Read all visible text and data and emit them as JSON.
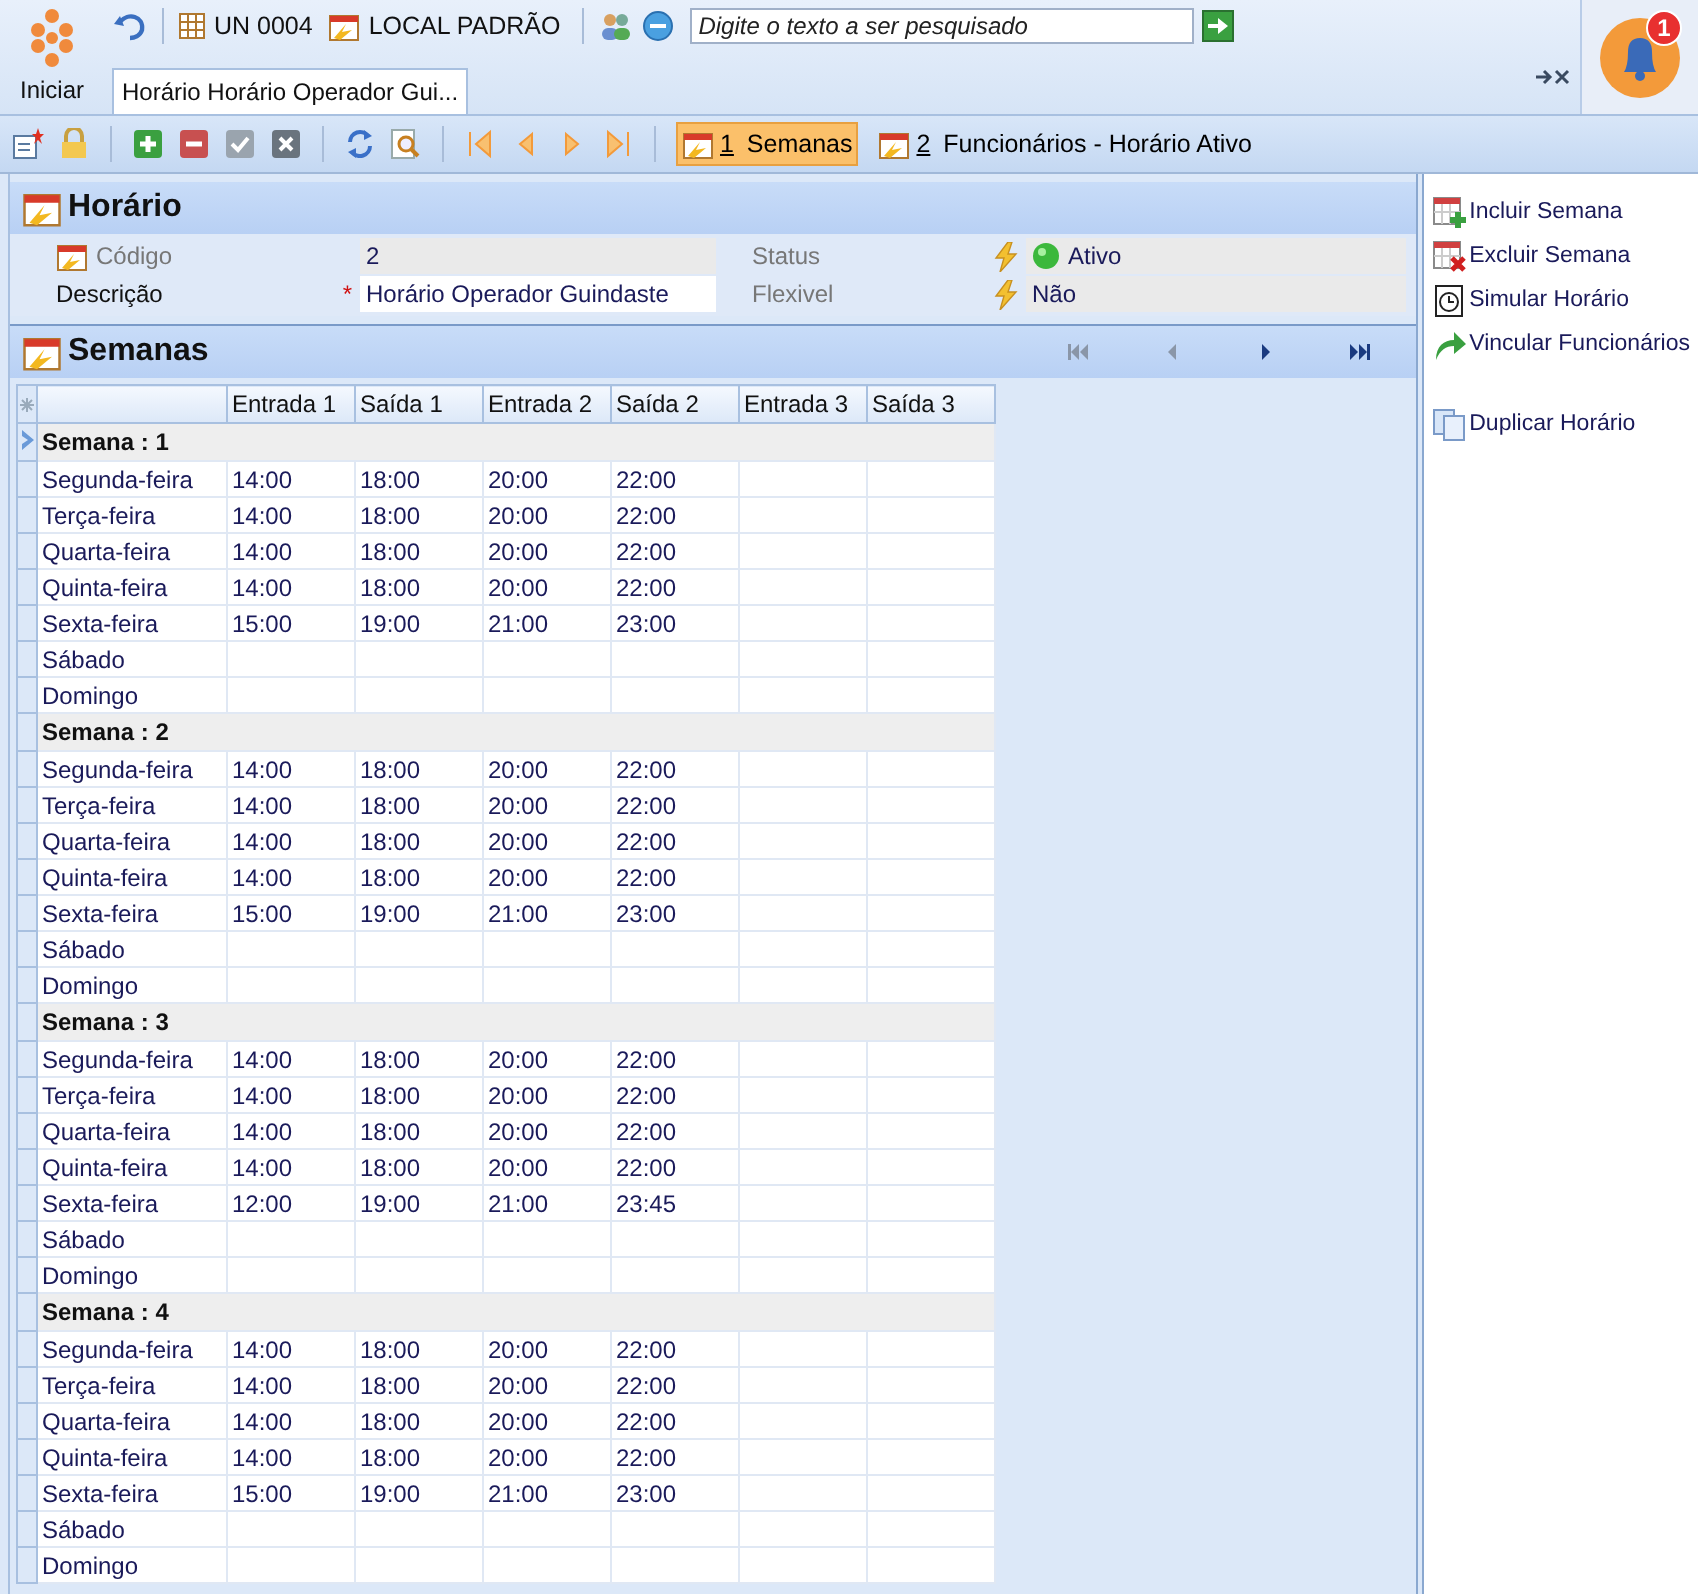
{
  "start": {
    "label": "Iniciar"
  },
  "topbar": {
    "unit": "UN 0004",
    "location": "LOCAL PADRÃO",
    "search": {
      "placeholder": "Digite o texto a ser pesquisado"
    }
  },
  "notifications": {
    "count": "1"
  },
  "tabs": [
    {
      "label": "Horário Horário Operador Gui...",
      "selected": true
    }
  ],
  "toolbar": [
    {
      "kind": "new"
    },
    {
      "kind": "lock"
    },
    {
      "kind": "add"
    },
    {
      "kind": "remove"
    },
    {
      "kind": "confirm",
      "disabled": true
    },
    {
      "kind": "cancel",
      "disabled": true
    },
    {
      "kind": "refresh"
    },
    {
      "kind": "find"
    },
    {
      "kind": "first"
    },
    {
      "kind": "prev"
    },
    {
      "kind": "next"
    },
    {
      "kind": "last"
    }
  ],
  "views": [
    {
      "key": "1",
      "label": "Semanas",
      "selected": true
    },
    {
      "key": "2",
      "label": "Funcionários - Horário Ativo",
      "selected": false
    }
  ],
  "form": {
    "title": "Horário",
    "rows": [
      [
        {
          "label": "Código",
          "value": "2",
          "kind": "text",
          "readonly": true,
          "icon": true
        },
        {
          "label": "Status",
          "value": "Ativo",
          "kind": "status",
          "readonly": true
        }
      ],
      [
        {
          "label": "Descrição",
          "value": "Horário Operador Guindaste",
          "kind": "text",
          "readonly": false,
          "marker": "*"
        },
        {
          "label": "Flexivel",
          "value": "Não",
          "kind": "text",
          "readonly": true
        }
      ]
    ]
  },
  "weeks_panel": {
    "title": "Semanas",
    "pager": [
      {
        "kind": "first",
        "disabled": true
      },
      {
        "kind": "prev",
        "disabled": true
      },
      {
        "kind": "next",
        "disabled": false
      },
      {
        "kind": "last",
        "disabled": false
      }
    ],
    "columns": [
      "Entrada 1",
      "Saída 1",
      "Entrada 2",
      "Saída 2",
      "Entrada 3",
      "Saída 3"
    ],
    "weeks": [
      {
        "title": "Semana : 1",
        "selected": true,
        "days": [
          {
            "day": "Segunda-feira",
            "times": [
              "14:00",
              "18:00",
              "20:00",
              "22:00"
            ]
          },
          {
            "day": "Terça-feira",
            "times": [
              "14:00",
              "18:00",
              "20:00",
              "22:00"
            ]
          },
          {
            "day": "Quarta-feira",
            "times": [
              "14:00",
              "18:00",
              "20:00",
              "22:00"
            ]
          },
          {
            "day": "Quinta-feira",
            "times": [
              "14:00",
              "18:00",
              "20:00",
              "22:00"
            ]
          },
          {
            "day": "Sexta-feira",
            "times": [
              "15:00",
              "19:00",
              "21:00",
              "23:00"
            ]
          },
          {
            "day": "Sábado"
          },
          {
            "day": "Domingo"
          }
        ]
      },
      {
        "title": "Semana : 2",
        "selected": false,
        "days": [
          {
            "day": "Segunda-feira",
            "times": [
              "14:00",
              "18:00",
              "20:00",
              "22:00"
            ]
          },
          {
            "day": "Terça-feira",
            "times": [
              "14:00",
              "18:00",
              "20:00",
              "22:00"
            ]
          },
          {
            "day": "Quarta-feira",
            "times": [
              "14:00",
              "18:00",
              "20:00",
              "22:00"
            ]
          },
          {
            "day": "Quinta-feira",
            "times": [
              "14:00",
              "18:00",
              "20:00",
              "22:00"
            ]
          },
          {
            "day": "Sexta-feira",
            "times": [
              "15:00",
              "19:00",
              "21:00",
              "23:00"
            ]
          },
          {
            "day": "Sábado"
          },
          {
            "day": "Domingo"
          }
        ]
      },
      {
        "title": "Semana : 3",
        "selected": false,
        "days": [
          {
            "day": "Segunda-feira",
            "times": [
              "14:00",
              "18:00",
              "20:00",
              "22:00"
            ]
          },
          {
            "day": "Terça-feira",
            "times": [
              "14:00",
              "18:00",
              "20:00",
              "22:00"
            ]
          },
          {
            "day": "Quarta-feira",
            "times": [
              "14:00",
              "18:00",
              "20:00",
              "22:00"
            ]
          },
          {
            "day": "Quinta-feira",
            "times": [
              "14:00",
              "18:00",
              "20:00",
              "22:00"
            ]
          },
          {
            "day": "Sexta-feira",
            "times": [
              "12:00",
              "19:00",
              "21:00",
              "23:45"
            ]
          },
          {
            "day": "Sábado"
          },
          {
            "day": "Domingo"
          }
        ]
      },
      {
        "title": "Semana : 4",
        "selected": false,
        "days": [
          {
            "day": "Segunda-feira",
            "times": [
              "14:00",
              "18:00",
              "20:00",
              "22:00"
            ]
          },
          {
            "day": "Terça-feira",
            "times": [
              "14:00",
              "18:00",
              "20:00",
              "22:00"
            ]
          },
          {
            "day": "Quarta-feira",
            "times": [
              "14:00",
              "18:00",
              "20:00",
              "22:00"
            ]
          },
          {
            "day": "Quinta-feira",
            "times": [
              "14:00",
              "18:00",
              "20:00",
              "22:00"
            ]
          },
          {
            "day": "Sexta-feira",
            "times": [
              "15:00",
              "19:00",
              "21:00",
              "23:00"
            ]
          },
          {
            "day": "Sábado"
          },
          {
            "day": "Domingo"
          }
        ]
      }
    ]
  },
  "actions": [
    [
      {
        "kind": "add-week",
        "label": "Incluir Semana"
      },
      {
        "kind": "delete-week",
        "label": "Excluir Semana"
      },
      {
        "kind": "simulate",
        "label": "Simular Horário"
      },
      {
        "kind": "link",
        "label": "Vincular Funcionários"
      }
    ],
    [
      {
        "kind": "duplicate",
        "label": "Duplicar Horário"
      }
    ]
  ]
}
